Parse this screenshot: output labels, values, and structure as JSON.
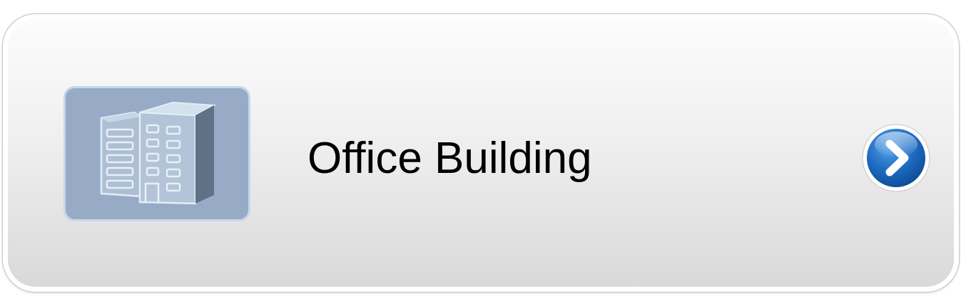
{
  "item": {
    "label": "Office Building",
    "icon": "office-building-icon",
    "action_icon": "chevron-right-circle-icon"
  },
  "colors": {
    "thumb_bg": "#97abc6",
    "arrow_blue": "#1e6cc2",
    "text": "#000000"
  }
}
